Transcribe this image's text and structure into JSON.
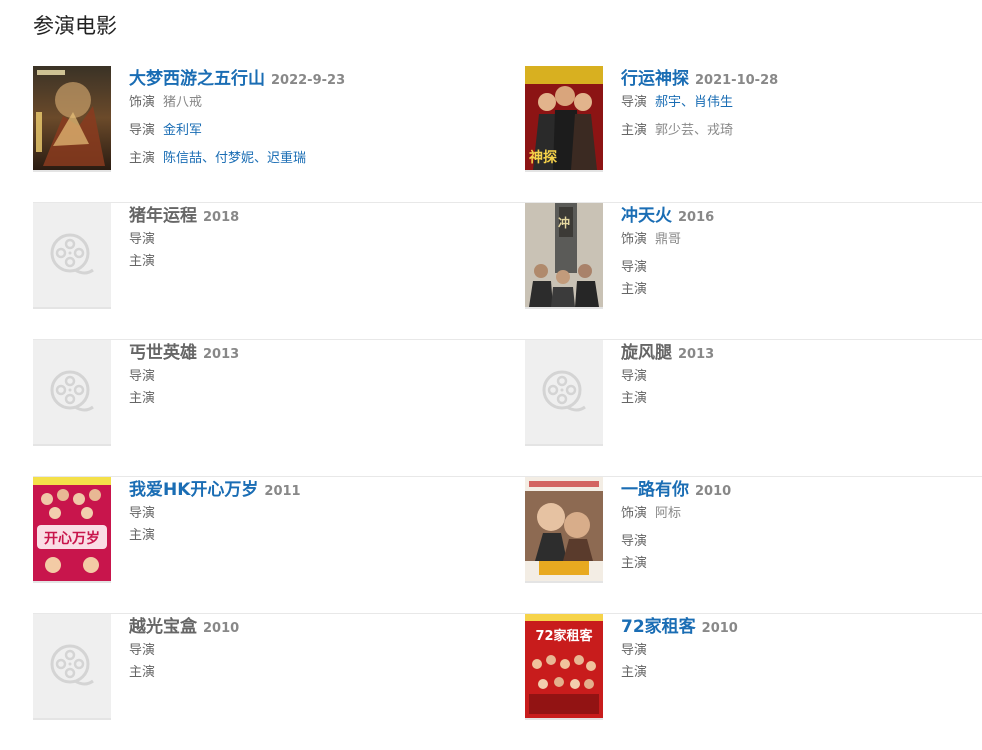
{
  "section": {
    "title": "参演电影"
  },
  "films": [
    {
      "title": "大梦西游之五行山",
      "year": "2022-9-23",
      "linked": true,
      "role_label": "饰演",
      "role": "猪八戒",
      "director_label": "导演",
      "director": "金利军",
      "cast_label": "主演",
      "cast": "陈信喆、付梦妮、迟重瑞",
      "poster": "poster-journey"
    },
    {
      "title": "行运神探",
      "year": "2021-10-28",
      "linked": true,
      "director_label": "导演",
      "director": "郝宇、肖伟生",
      "cast_label": "主演",
      "cast": "郭少芸、戎琦",
      "poster": "poster-detective"
    },
    {
      "title": "猪年运程",
      "year": "2018",
      "linked": false,
      "director_label": "导演",
      "director": "",
      "cast_label": "主演",
      "cast": "",
      "poster": "placeholder"
    },
    {
      "title": "冲天火",
      "year": "2016",
      "linked": true,
      "role_label": "饰演",
      "role": "鼎哥",
      "director_label": "导演",
      "director": "",
      "cast_label": "主演",
      "cast": "",
      "poster": "poster-firestorm"
    },
    {
      "title": "丐世英雄",
      "year": "2013",
      "linked": false,
      "director_label": "导演",
      "director": "",
      "cast_label": "主演",
      "cast": "",
      "poster": "placeholder"
    },
    {
      "title": "旋风腿",
      "year": "2013",
      "linked": false,
      "director_label": "导演",
      "director": "",
      "cast_label": "主演",
      "cast": "",
      "poster": "placeholder"
    },
    {
      "title": "我爱HK开心万岁",
      "year": "2011",
      "linked": true,
      "director_label": "导演",
      "director": "",
      "cast_label": "主演",
      "cast": "",
      "poster": "poster-hk"
    },
    {
      "title": "一路有你",
      "year": "2010",
      "linked": true,
      "role_label": "饰演",
      "role": "阿标",
      "director_label": "导演",
      "director": "",
      "cast_label": "主演",
      "cast": "",
      "poster": "poster-withyou"
    },
    {
      "title": "越光宝盒",
      "year": "2010",
      "linked": false,
      "director_label": "导演",
      "director": "",
      "cast_label": "主演",
      "cast": "",
      "poster": "placeholder"
    },
    {
      "title": "72家租客",
      "year": "2010",
      "linked": true,
      "director_label": "导演",
      "director": "",
      "cast_label": "主演",
      "cast": "",
      "poster": "poster-72tenants"
    }
  ],
  "poster_text": {
    "hk_title": "开心万岁",
    "tenants_title": "72家租客"
  },
  "colors": {
    "link": "#1a6db4",
    "placeholder_bg": "#efefef",
    "placeholder_icon": "#d4d4d4"
  }
}
